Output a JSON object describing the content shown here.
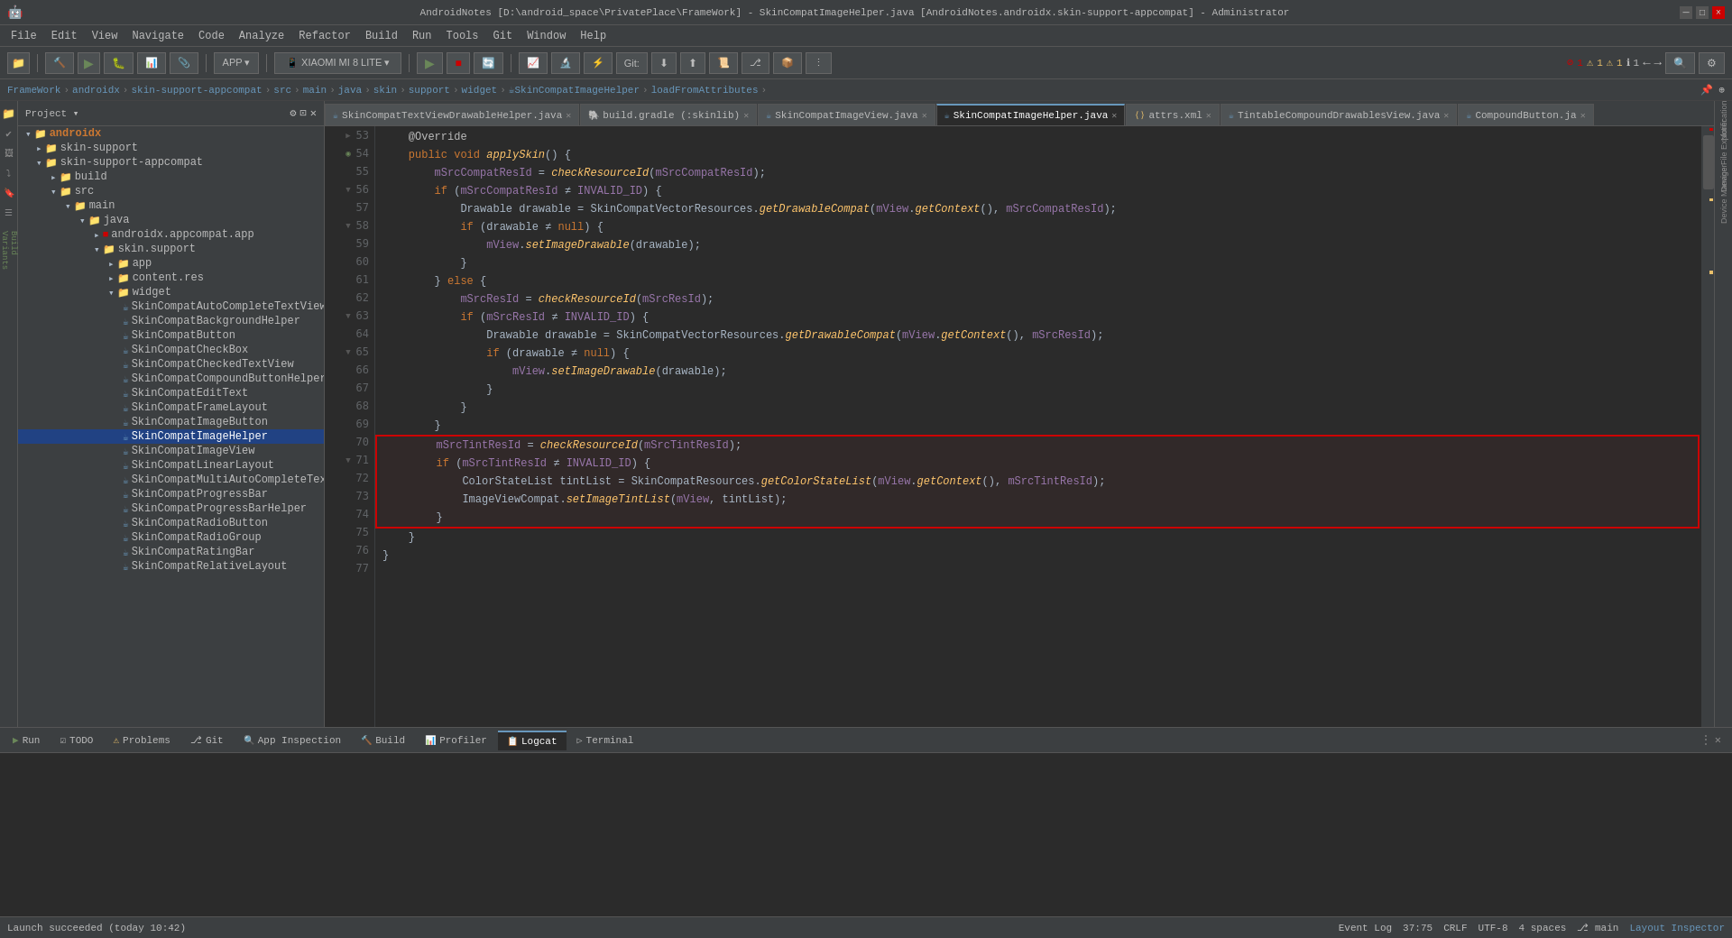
{
  "titleBar": {
    "title": "AndroidNotes [D:\\android_space\\PrivatePlace\\FrameWork] - SkinCompatImageHelper.java [AndroidNotes.androidx.skin-support-appcompat] - Administrator",
    "minLabel": "─",
    "maxLabel": "□",
    "closeLabel": "×"
  },
  "menuBar": {
    "items": [
      "File",
      "Edit",
      "View",
      "Navigate",
      "Code",
      "Analyze",
      "Refactor",
      "Build",
      "Run",
      "Tools",
      "Git",
      "Window",
      "Help"
    ]
  },
  "breadcrumb": {
    "items": [
      "FrameWork",
      "androidx",
      "skin-support-appcompat",
      "src",
      "main",
      "java",
      "skin",
      "support",
      "widget",
      "SkinCompatImageHelper",
      "loadFromAttributes"
    ]
  },
  "tabs": [
    {
      "name": "SkinCompatTextViewDrawableHelper.java",
      "type": "java",
      "active": false
    },
    {
      "name": "build.gradle (:skinlib)",
      "type": "gradle",
      "active": false
    },
    {
      "name": "SkinCompatImageView.java",
      "type": "java",
      "active": false
    },
    {
      "name": "SkinCompatImageHelper.java",
      "type": "java",
      "active": true
    },
    {
      "name": "attrs.xml",
      "type": "xml",
      "active": false
    },
    {
      "name": "TintableCompoundDrawablesView.java",
      "type": "java",
      "active": false
    },
    {
      "name": "CompoundButton.ja",
      "type": "java",
      "active": false
    }
  ],
  "codeLines": [
    {
      "num": "53",
      "content": "    @Override",
      "type": "annotation"
    },
    {
      "num": "54",
      "content": "    public void applySkin() {",
      "type": "code"
    },
    {
      "num": "55",
      "content": "        mSrcCompatResId = checkResourceId(mSrcCompatResId);",
      "type": "code"
    },
    {
      "num": "56",
      "content": "        if (mSrcCompatResId ≠ INVALID_ID) {",
      "type": "code"
    },
    {
      "num": "57",
      "content": "            Drawable drawable = SkinCompatVectorResources.getDrawableCompat(mView.getContext(), mSrcCompatResId);",
      "type": "code"
    },
    {
      "num": "58",
      "content": "            if (drawable ≠ null) {",
      "type": "code"
    },
    {
      "num": "59",
      "content": "                mView.setImageDrawable(drawable);",
      "type": "code"
    },
    {
      "num": "60",
      "content": "            }",
      "type": "code"
    },
    {
      "num": "61",
      "content": "        } else {",
      "type": "code"
    },
    {
      "num": "62",
      "content": "            mSrcResId = checkResourceId(mSrcResId);",
      "type": "code"
    },
    {
      "num": "63",
      "content": "            if (mSrcResId ≠ INVALID_ID) {",
      "type": "code"
    },
    {
      "num": "64",
      "content": "                Drawable drawable = SkinCompatVectorResources.getDrawableCompat(mView.getContext(), mSrcResId);",
      "type": "code"
    },
    {
      "num": "65",
      "content": "                if (drawable ≠ null) {",
      "type": "code"
    },
    {
      "num": "66",
      "content": "                    mView.setImageDrawable(drawable);",
      "type": "code"
    },
    {
      "num": "67",
      "content": "                }",
      "type": "code"
    },
    {
      "num": "68",
      "content": "            }",
      "type": "code"
    },
    {
      "num": "69",
      "content": "        }",
      "type": "code"
    },
    {
      "num": "70",
      "content": "        mSrcTintResId = checkResourceId(mSrcTintResId);",
      "type": "highlighted"
    },
    {
      "num": "71",
      "content": "        if (mSrcTintResId ≠ INVALID_ID) {",
      "type": "highlighted"
    },
    {
      "num": "72",
      "content": "            ColorStateList tintList = SkinCompatResources.getColorStateList(mView.getContext(), mSrcTintResId);",
      "type": "highlighted"
    },
    {
      "num": "73",
      "content": "            ImageViewCompat.setImageTintList(mView, tintList);",
      "type": "highlighted"
    },
    {
      "num": "74",
      "content": "        }",
      "type": "highlighted"
    },
    {
      "num": "75",
      "content": "    }",
      "type": "code"
    },
    {
      "num": "76",
      "content": "}",
      "type": "code"
    },
    {
      "num": "77",
      "content": "",
      "type": "code"
    }
  ],
  "projectTree": {
    "title": "Project",
    "items": [
      {
        "label": "androidx",
        "level": 0,
        "type": "folder",
        "expanded": true
      },
      {
        "label": "skin-support",
        "level": 1,
        "type": "folder",
        "expanded": false
      },
      {
        "label": "skin-support-appcompat",
        "level": 1,
        "type": "folder",
        "expanded": true
      },
      {
        "label": "build",
        "level": 2,
        "type": "folder",
        "expanded": false
      },
      {
        "label": "src",
        "level": 2,
        "type": "folder",
        "expanded": true
      },
      {
        "label": "main",
        "level": 3,
        "type": "folder",
        "expanded": true
      },
      {
        "label": "java",
        "level": 4,
        "type": "folder",
        "expanded": true
      },
      {
        "label": "androidx.appcompat.app",
        "level": 5,
        "type": "java",
        "expanded": false
      },
      {
        "label": "skin.support",
        "level": 5,
        "type": "folder",
        "expanded": true
      },
      {
        "label": "app",
        "level": 6,
        "type": "folder",
        "expanded": false
      },
      {
        "label": "content.res",
        "level": 6,
        "type": "folder",
        "expanded": false
      },
      {
        "label": "widget",
        "level": 6,
        "type": "folder",
        "expanded": true
      },
      {
        "label": "SkinCompatAutoCompleteTextView",
        "level": 7,
        "type": "file"
      },
      {
        "label": "SkinCompatBackgroundHelper",
        "level": 7,
        "type": "file"
      },
      {
        "label": "SkinCompatButton",
        "level": 7,
        "type": "file"
      },
      {
        "label": "SkinCompatCheckBox",
        "level": 7,
        "type": "file"
      },
      {
        "label": "SkinCompatCheckedTextView",
        "level": 7,
        "type": "file"
      },
      {
        "label": "SkinCompatCompoundButtonHelper",
        "level": 7,
        "type": "file"
      },
      {
        "label": "SkinCompatEditText",
        "level": 7,
        "type": "file"
      },
      {
        "label": "SkinCompatFrameLayout",
        "level": 7,
        "type": "file"
      },
      {
        "label": "SkinCompatImageButton",
        "level": 7,
        "type": "file"
      },
      {
        "label": "SkinCompatImageHelper",
        "level": 7,
        "type": "file",
        "selected": true
      },
      {
        "label": "SkinCompatImageView",
        "level": 7,
        "type": "file"
      },
      {
        "label": "SkinCompatLinearLayout",
        "level": 7,
        "type": "file"
      },
      {
        "label": "SkinCompatMultiAutoCompleteTextView",
        "level": 7,
        "type": "file"
      },
      {
        "label": "SkinCompatProgressBar",
        "level": 7,
        "type": "file"
      },
      {
        "label": "SkinCompatProgressBarHelper",
        "level": 7,
        "type": "file"
      },
      {
        "label": "SkinCompatRadioButton",
        "level": 7,
        "type": "file"
      },
      {
        "label": "SkinCompatRadioGroup",
        "level": 7,
        "type": "file"
      },
      {
        "label": "SkinCompatRatingBar",
        "level": 7,
        "type": "file"
      },
      {
        "label": "SkinCompatRelativeLayout",
        "level": 7,
        "type": "file"
      }
    ]
  },
  "bottomTabs": [
    {
      "label": "Run",
      "icon": "▶"
    },
    {
      "label": "TODO",
      "icon": "☑"
    },
    {
      "label": "Problems",
      "icon": "⚠"
    },
    {
      "label": "Git",
      "icon": "⎇"
    },
    {
      "label": "App Inspection",
      "icon": "🔍"
    },
    {
      "label": "Build",
      "icon": "🔨"
    },
    {
      "label": "Profiler",
      "icon": "📊"
    },
    {
      "label": "Logcat",
      "icon": "📋",
      "active": true
    },
    {
      "label": "Terminal",
      "icon": ">"
    }
  ],
  "statusBar": {
    "message": "Launch succeeded (today 10:42)",
    "position": "37:75",
    "encoding": "CRLF",
    "charSet": "UTF-8",
    "indent": "4 spaces",
    "branch": "main",
    "eventLog": "Event Log",
    "layoutInspector": "Layout Inspector"
  },
  "toolbar": {
    "appLabel": "APP",
    "deviceLabel": "XIAOMI MI 8 LITE",
    "gitLabel": "Git:"
  },
  "errorInfo": {
    "errors": "1",
    "warnings1": "1",
    "warnings2": "1",
    "plus": "1"
  },
  "rightSideLabels": [
    "Notifications",
    "Device File Explorer",
    "Device Manager",
    "Build Variants",
    "Favorites"
  ]
}
